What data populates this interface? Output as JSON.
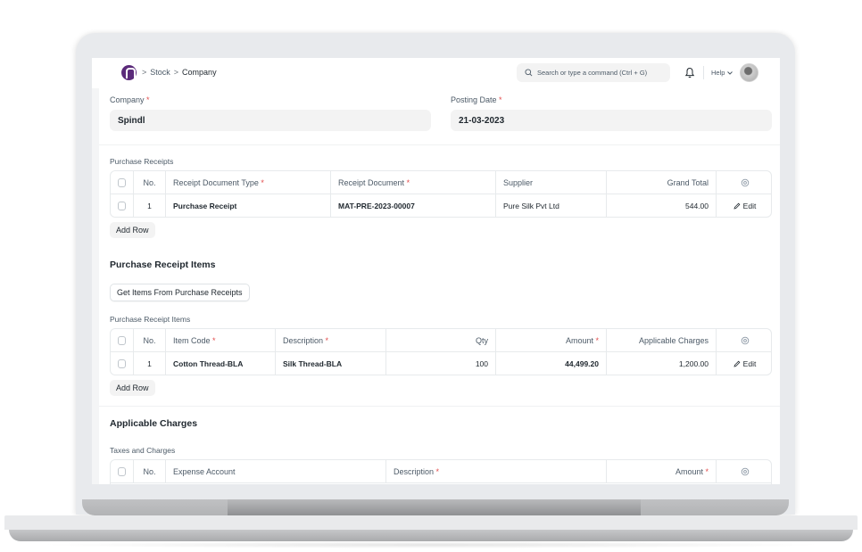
{
  "navbar": {
    "logo_icon": "app-logo-icon",
    "breadcrumbs": [
      "Stock",
      "Company"
    ],
    "breadcrumb_separator": ">",
    "search_placeholder": "Search or type a command (Ctrl + G)",
    "help_label": "Help",
    "notification_icon": "bell-icon",
    "avatar_icon": "user-avatar"
  },
  "form": {
    "company": {
      "label": "Company",
      "required_mark": "*",
      "value": "Spindl"
    },
    "posting_date": {
      "label": "Posting Date",
      "required_mark": "*",
      "value": "21-03-2023"
    }
  },
  "purchase_receipts": {
    "label": "Purchase Receipts",
    "columns": [
      {
        "label": "No.",
        "required": false
      },
      {
        "label": "Receipt Document Type",
        "required": true
      },
      {
        "label": "Receipt Document",
        "required": true
      },
      {
        "label": "Supplier",
        "required": false
      },
      {
        "label": "Grand Total",
        "required": false
      }
    ],
    "rows": [
      {
        "no": "1",
        "receipt_document_type": "Purchase Receipt",
        "receipt_document": "MAT-PRE-2023-00007",
        "supplier": "Pure Silk Pvt Ltd",
        "grand_total": "544.00",
        "edit_label": "Edit"
      }
    ],
    "add_row_label": "Add Row"
  },
  "purchase_receipt_items_section": {
    "title": "Purchase Receipt Items",
    "get_items_button": "Get Items From Purchase Receipts",
    "table_label": "Purchase Receipt Items",
    "columns": [
      {
        "label": "No.",
        "required": false
      },
      {
        "label": "Item Code",
        "required": true
      },
      {
        "label": "Description",
        "required": true
      },
      {
        "label": "Qty",
        "required": false
      },
      {
        "label": "Amount",
        "required": true
      },
      {
        "label": "Applicable Charges",
        "required": false
      }
    ],
    "rows": [
      {
        "no": "1",
        "item_code": "Cotton Thread-BLA",
        "description": "Silk Thread-BLA",
        "qty": "100",
        "amount": "44,499.20",
        "applicable_charges": "1,200.00",
        "edit_label": "Edit"
      }
    ],
    "add_row_label": "Add Row"
  },
  "applicable_charges_section": {
    "title": "Applicable Charges",
    "table_label": "Taxes and Charges",
    "columns": [
      {
        "label": "No.",
        "required": false
      },
      {
        "label": "Expense Account",
        "required": false
      },
      {
        "label": "Description",
        "required": true
      },
      {
        "label": "Amount",
        "required": true
      }
    ]
  },
  "colors": {
    "logo": "#5b2a7a",
    "required": "#e24c4c",
    "text": "#1f272e",
    "muted_text": "#4c5a67",
    "input_bg": "#f3f3f3",
    "border": "#e7eaec"
  }
}
